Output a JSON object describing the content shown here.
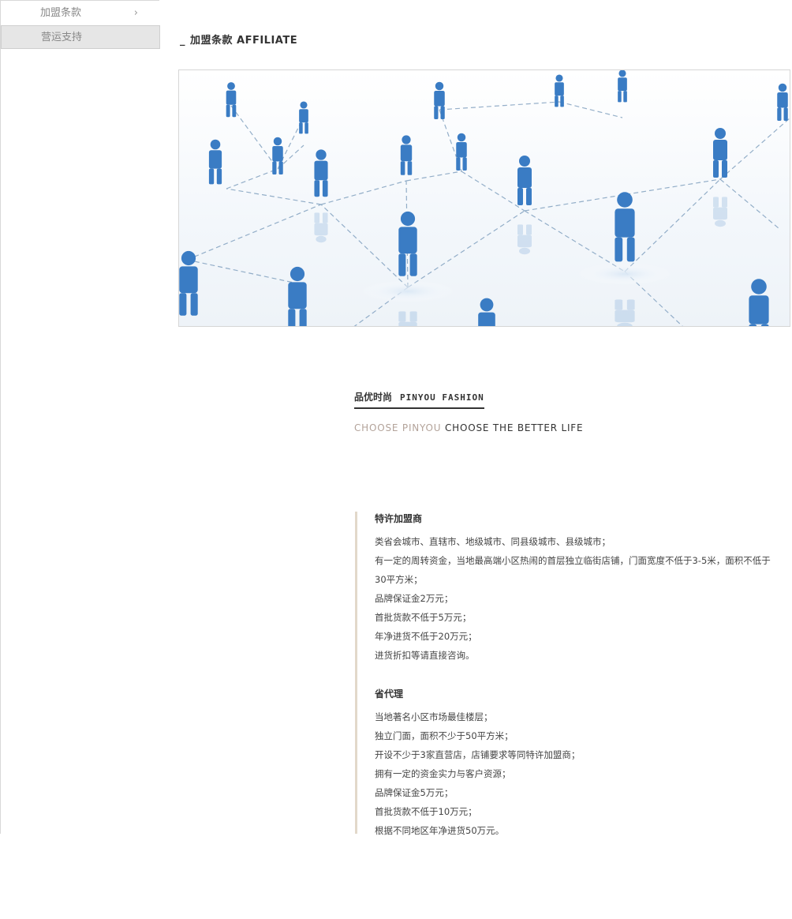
{
  "sidebar": {
    "items": [
      {
        "label": "加盟条款",
        "chevron": "chevron-right-icon",
        "active": false
      },
      {
        "label": "营运支持",
        "active": true
      }
    ]
  },
  "header": {
    "dash": "_",
    "title": "加盟条款 AFFILIATE"
  },
  "banner": {
    "subject": "network-of-people-illustration",
    "color": "#3a7cc4"
  },
  "brand": {
    "cn": "品优时尚",
    "en": "PINYOU FASHION"
  },
  "slogan": {
    "part1": "CHOOSE PINYOU",
    "part2": "CHOOSE THE BETTER LIFE",
    "part1_color": "#b3a39a"
  },
  "sections": [
    {
      "title": "特许加盟商",
      "lines": [
        "类省会城市、直辖市、地级城市、同县级城市、县级城市；",
        "有一定的周转资金，当地最高端小区热闹的首层独立临街店铺，门面宽度不低于3-5米，面积不低于",
        "30平方米；",
        "品牌保证金2万元；",
        "首批货款不低于5万元；",
        "年净进货不低于20万元；",
        "进货折扣等请直接咨询。"
      ]
    },
    {
      "title": "省代理",
      "lines": [
        "当地著名小区市场最佳楼层；",
        "独立门面，面积不少于50平方米；",
        "开设不少于3家直营店，店铺要求等同特许加盟商；",
        "拥有一定的资金实力与客户资源；",
        "品牌保证金5万元；",
        "首批货款不低于10万元；",
        "根据不同地区年净进货50万元。"
      ]
    }
  ]
}
